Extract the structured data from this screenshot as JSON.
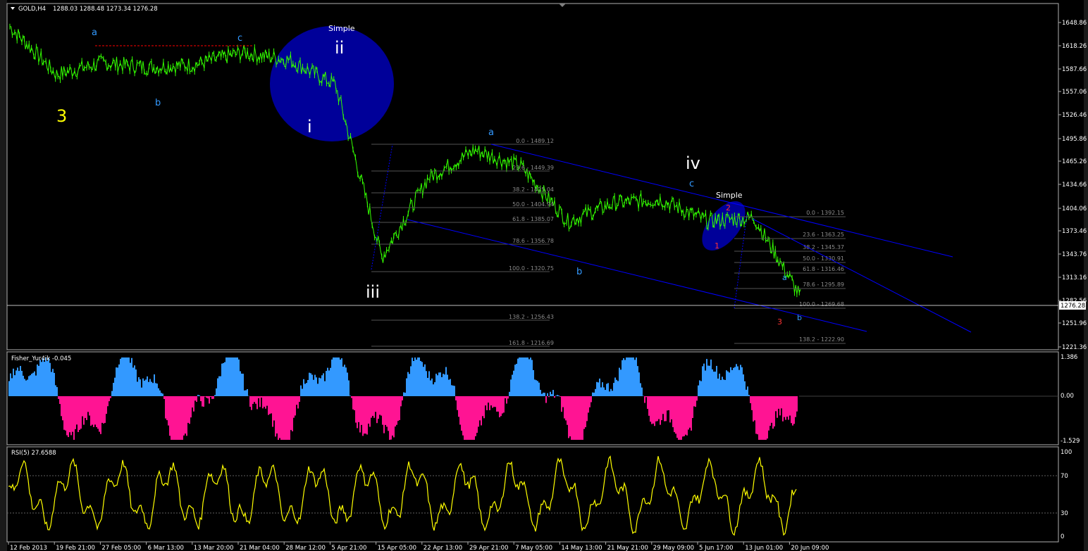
{
  "window": {
    "header_symbol": "GOLD,H4",
    "header_ohlc": "1288.03 1288.48 1273.34 1276.28",
    "current_price_label": "1276.28"
  },
  "main_panel": {
    "price_axis_ticks": [
      "1648.86",
      "1618.26",
      "1587.66",
      "1557.06",
      "1526.46",
      "1495.86",
      "1465.26",
      "1434.66",
      "1404.06",
      "1373.46",
      "1343.76",
      "1313.16",
      "1282.56",
      "1251.96",
      "1221.36"
    ],
    "wave_labels": {
      "w3": "3",
      "a1": "a",
      "b1": "b",
      "c1": "c",
      "simple1": "Simple",
      "ii": "ii",
      "i": "i",
      "iii": "iii",
      "a2": "a",
      "b2": "b",
      "iv": "iv",
      "c2": "c",
      "simple2": "Simple",
      "n2": "2",
      "n1": "1",
      "n3": "3",
      "a3": "a",
      "b3": "b"
    },
    "fib_left": [
      "0.0 - 1489.12",
      "23.6 - 1449.39",
      "38.2 - 1425.04",
      "50.0 - 1404.94",
      "61.8 - 1385.07",
      "78.6 - 1356.78",
      "100.0 - 1320.75",
      "138.2 - 1256.43",
      "161.8 - 1216.69"
    ],
    "fib_right": [
      "0.0 - 1392.15",
      "23.6 - 1363.25",
      "38.2 - 1345.37",
      "50.0 - 1330.91",
      "61.8 - 1316.46",
      "78.6 - 1295.89",
      "100.0 - 1269.68",
      "138.2 - 1222.90"
    ]
  },
  "fisher_panel": {
    "label": "Fisher_Yur4ik -0.045",
    "axis_ticks": [
      "1.386",
      "0.00",
      "-1.529"
    ]
  },
  "rsi_panel": {
    "label": "RSI(5) 27.6588",
    "axis_ticks": [
      "100",
      "70",
      "30",
      "0"
    ]
  },
  "time_axis": [
    "12 Feb 2013",
    "19 Feb 21:00",
    "27 Feb 05:00",
    "6 Mar 13:00",
    "13 Mar 20:00",
    "21 Mar 04:00",
    "28 Mar 12:00",
    "5 Apr 21:00",
    "15 Apr 05:00",
    "22 Apr 13:00",
    "29 Apr 21:00",
    "7 May 05:00",
    "14 May 13:00",
    "21 May 21:00",
    "29 May 09:00",
    "5 Jun 17:00",
    "13 Jun 01:00",
    "20 Jun 09:00"
  ],
  "colors": {
    "price_line": "#33ff00",
    "fisher_pos": "#3399ff",
    "fisher_neg": "#ff1493",
    "rsi_line": "#ffff00",
    "channel": "#0000ff",
    "ellipse": "#000099",
    "wave_major": "#ffffff",
    "wave_minor": "#3399ff",
    "wave_3": "#ffff00",
    "wave_red": "#ff3333"
  },
  "chart_data": {
    "type": "line",
    "x": [
      "12 Feb 2013",
      "19 Feb 21:00",
      "27 Feb 05:00",
      "6 Mar 13:00",
      "13 Mar 20:00",
      "21 Mar 04:00",
      "28 Mar 12:00",
      "5 Apr 21:00",
      "15 Apr 05:00",
      "22 Apr 13:00",
      "29 Apr 21:00",
      "7 May 05:00",
      "14 May 13:00",
      "21 May 21:00",
      "29 May 09:00",
      "5 Jun 17:00",
      "13 Jun 01:00",
      "20 Jun 09:00"
    ],
    "series": [
      {
        "name": "GOLD,H4",
        "values": [
          1648,
          1582,
          1598,
          1592,
          1596,
          1612,
          1602,
          1568,
          1330,
          1440,
          1478,
          1455,
          1380,
          1405,
          1410,
          1380,
          1385,
          1276
        ]
      }
    ],
    "ylim": [
      1210,
      1665
    ],
    "grid": false,
    "legend": "none"
  }
}
